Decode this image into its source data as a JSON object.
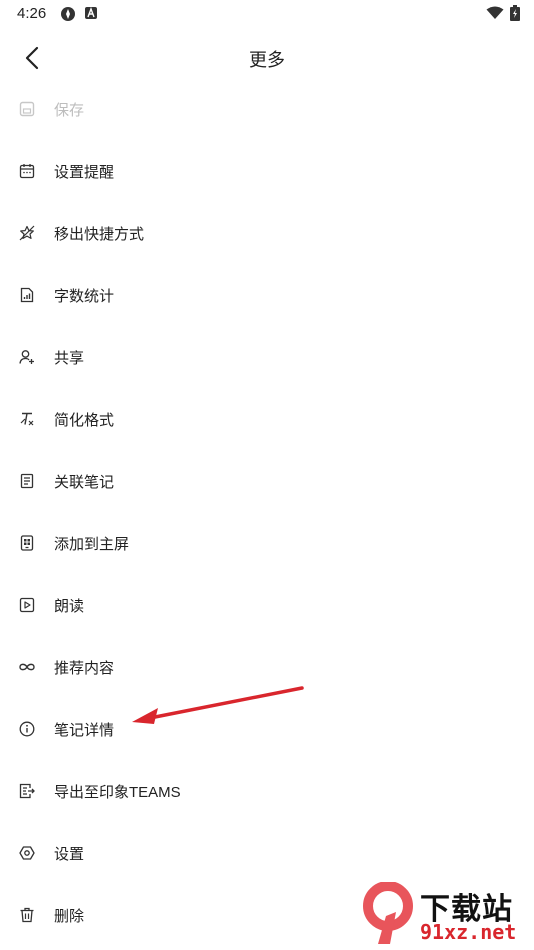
{
  "status_bar": {
    "time": "4:26"
  },
  "header": {
    "title": "更多",
    "back_icon": "chevron-left-icon"
  },
  "menu": {
    "items": [
      {
        "label": "保存",
        "icon": "save-icon",
        "disabled": true
      },
      {
        "label": "设置提醒",
        "icon": "calendar-icon"
      },
      {
        "label": "移出快捷方式",
        "icon": "star-remove-icon"
      },
      {
        "label": "字数统计",
        "icon": "document-chart-icon"
      },
      {
        "label": "共享",
        "icon": "share-user-icon"
      },
      {
        "label": "简化格式",
        "icon": "clear-format-icon"
      },
      {
        "label": "关联笔记",
        "icon": "linked-note-icon"
      },
      {
        "label": "添加到主屏",
        "icon": "home-screen-icon"
      },
      {
        "label": "朗读",
        "icon": "play-icon"
      },
      {
        "label": "推荐内容",
        "icon": "infinity-icon"
      },
      {
        "label": "笔记详情",
        "icon": "info-icon"
      },
      {
        "label": "导出至印象TEAMS",
        "icon": "export-icon"
      },
      {
        "label": "设置",
        "icon": "settings-icon"
      },
      {
        "label": "删除",
        "icon": "trash-icon"
      }
    ]
  },
  "watermark": {
    "top": "下载站",
    "bottom": "91xz.net"
  },
  "colors": {
    "annotation_arrow": "#d9262d",
    "text": "#222222",
    "disabled": "#bdbdbd"
  }
}
